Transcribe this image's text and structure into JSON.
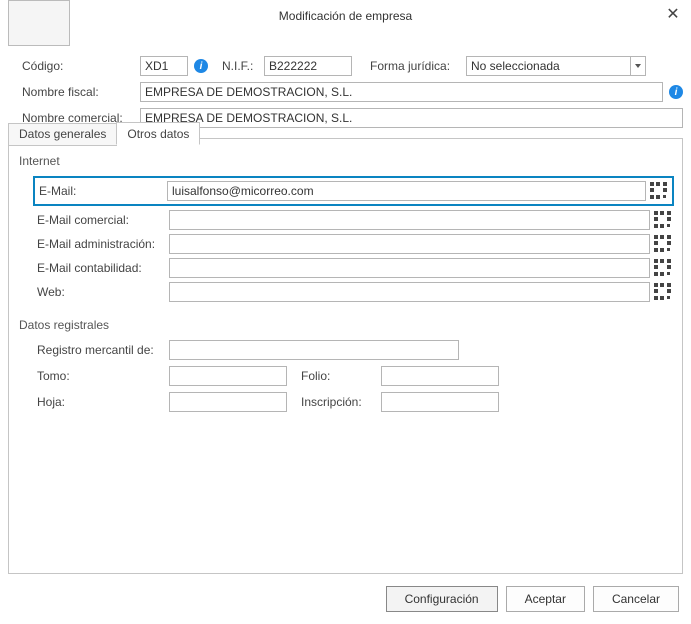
{
  "window": {
    "title": "Modificación de empresa",
    "close_label": "✕"
  },
  "header": {
    "codigo_label": "Código:",
    "codigo_value": "XD1",
    "nif_label": "N.I.F.:",
    "nif_value": "B222222",
    "forma_label": "Forma jurídica:",
    "forma_value": "No seleccionada",
    "nombre_fiscal_label": "Nombre fiscal:",
    "nombre_fiscal_value": "EMPRESA DE DEMOSTRACION, S.L.",
    "nombre_comercial_label": "Nombre comercial:",
    "nombre_comercial_value": "EMPRESA DE DEMOSTRACION, S.L."
  },
  "tabs": {
    "general": "Datos generales",
    "otros": "Otros datos"
  },
  "internet": {
    "section": "Internet",
    "email_label": "E-Mail:",
    "email_value": "luisalfonso@micorreo.com",
    "email_com_label": "E-Mail comercial:",
    "email_com_value": "",
    "email_adm_label": "E-Mail administración:",
    "email_adm_value": "",
    "email_cont_label": "E-Mail contabilidad:",
    "email_cont_value": "",
    "web_label": "Web:",
    "web_value": ""
  },
  "registrales": {
    "section": "Datos registrales",
    "registro_label": "Registro mercantil de:",
    "registro_value": "",
    "tomo_label": "Tomo:",
    "tomo_value": "",
    "folio_label": "Folio:",
    "folio_value": "",
    "hoja_label": "Hoja:",
    "hoja_value": "",
    "inscripcion_label": "Inscripción:",
    "inscripcion_value": ""
  },
  "footer": {
    "config": "Configuración",
    "accept": "Aceptar",
    "cancel": "Cancelar"
  },
  "icons": {
    "info": "i"
  }
}
